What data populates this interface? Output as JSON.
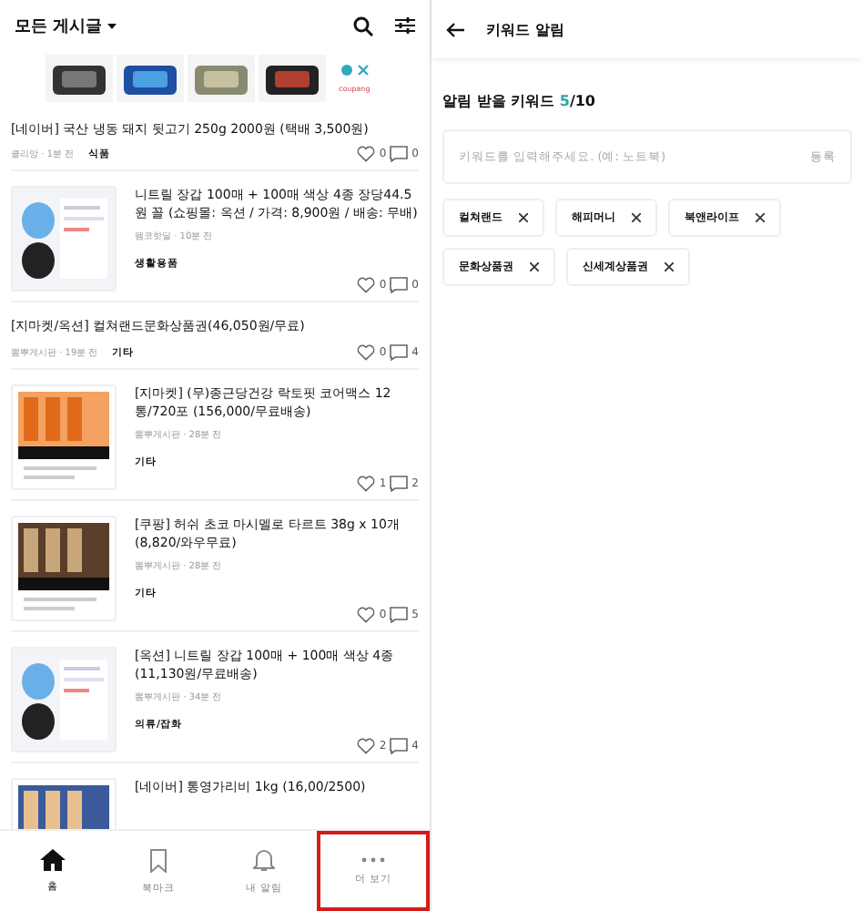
{
  "feed": {
    "board_title": "모든 게시글",
    "ad": {
      "brand": "coupang"
    },
    "posts": [
      {
        "kind": "text",
        "title": "[네이버] 국산 냉동 돼지 뒷고기 250g 2000원 (택배 3,500원)",
        "meta": "클리앙 · 1분 전",
        "category": "식품",
        "likes": "0",
        "comments": "0"
      },
      {
        "kind": "thumb",
        "title": "니트릴 장갑 100매 + 100매 색상 4종 장당44.5원 꼴 (쇼핑몰: 옥션 / 가격: 8,900원 / 배송: 무배)",
        "meta": "펨코핫딜 · 10분 전",
        "category": "생활용품",
        "likes": "0",
        "comments": "0"
      },
      {
        "kind": "text",
        "title": "[지마켓/옥션] 컬쳐랜드문화상품권(46,050원/무료)",
        "meta": "뽐뿌게시판 · 19분 전",
        "category": "기타",
        "likes": "0",
        "comments": "4"
      },
      {
        "kind": "thumb",
        "title": "[지마켓] (무)종근당건강 락토핏 코어맥스 12통/720포 (156,000/무료배송)",
        "meta": "뽐뿌게시판 · 28분 전",
        "category": "기타",
        "likes": "1",
        "comments": "2"
      },
      {
        "kind": "thumb",
        "title": "[쿠팡] 허쉬 초코 마시멜로 타르트 38g x 10개 (8,820/와우무료)",
        "meta": "뽐뿌게시판 · 28분 전",
        "category": "기타",
        "likes": "0",
        "comments": "5"
      },
      {
        "kind": "thumb",
        "title": "[옥션] 니트릴 장갑 100매 + 100매 색상 4종 (11,130원/무료배송)",
        "meta": "뽐뿌게시판 · 34분 전",
        "category": "의류/잡화",
        "likes": "2",
        "comments": "4"
      },
      {
        "kind": "thumb",
        "title": "[네이버] 통영가리비 1kg (16,00/2500)"
      }
    ],
    "nav": [
      {
        "label": "홈",
        "kind": "home",
        "selected": true,
        "highlighted": false
      },
      {
        "label": "북마크",
        "kind": "bookmark",
        "selected": false,
        "highlighted": false
      },
      {
        "label": "내 알림",
        "kind": "bell",
        "selected": false,
        "highlighted": false
      },
      {
        "label": "더 보기",
        "kind": "more",
        "selected": false,
        "highlighted": true
      }
    ]
  },
  "alerts": {
    "title": "키워드 알림",
    "heading": "알림 받을 키워드",
    "count": "5",
    "limit": "/10",
    "placeholder": "키워드를 입력해주세요. (예: 노트북)",
    "register": "등록",
    "keywords": [
      "컬쳐랜드",
      "해피머니",
      "북앤라이프",
      "문화상품권",
      "신세계상품권"
    ]
  }
}
